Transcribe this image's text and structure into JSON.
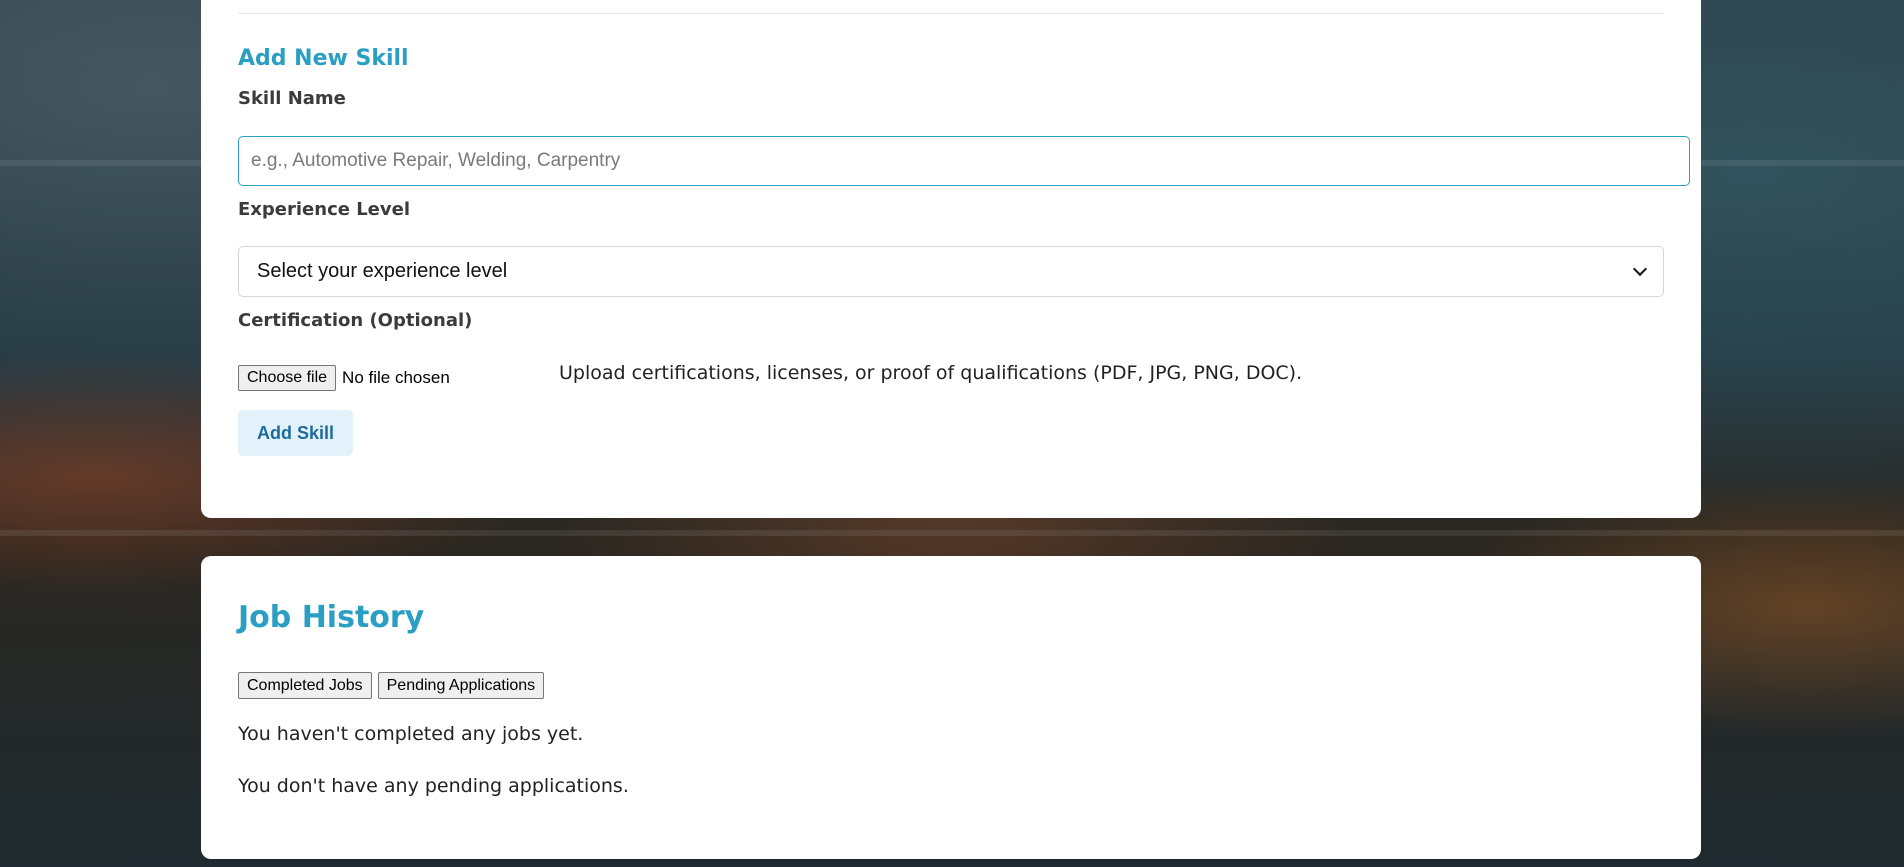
{
  "add_skill": {
    "title": "Add New Skill",
    "skill_name_label": "Skill Name",
    "skill_name_placeholder": "e.g., Automotive Repair, Welding, Carpentry",
    "experience_label": "Experience Level",
    "experience_selected": "Select your experience level",
    "certification_label": "Certification (Optional)",
    "file_button": "Choose file",
    "file_status": "No file chosen",
    "certification_hint": "Upload certifications, licenses, or proof of qualifications (PDF, JPG, PNG, DOC).",
    "submit_label": "Add Skill"
  },
  "job_history": {
    "title": "Job History",
    "tabs": [
      "Completed Jobs",
      "Pending Applications"
    ],
    "completed_message": "You haven't completed any jobs yet.",
    "pending_message": "You don't have any pending applications."
  },
  "colors": {
    "accent": "#2a9fc3",
    "button_bg": "#e3f1fa",
    "button_text": "#1d6c9d"
  }
}
